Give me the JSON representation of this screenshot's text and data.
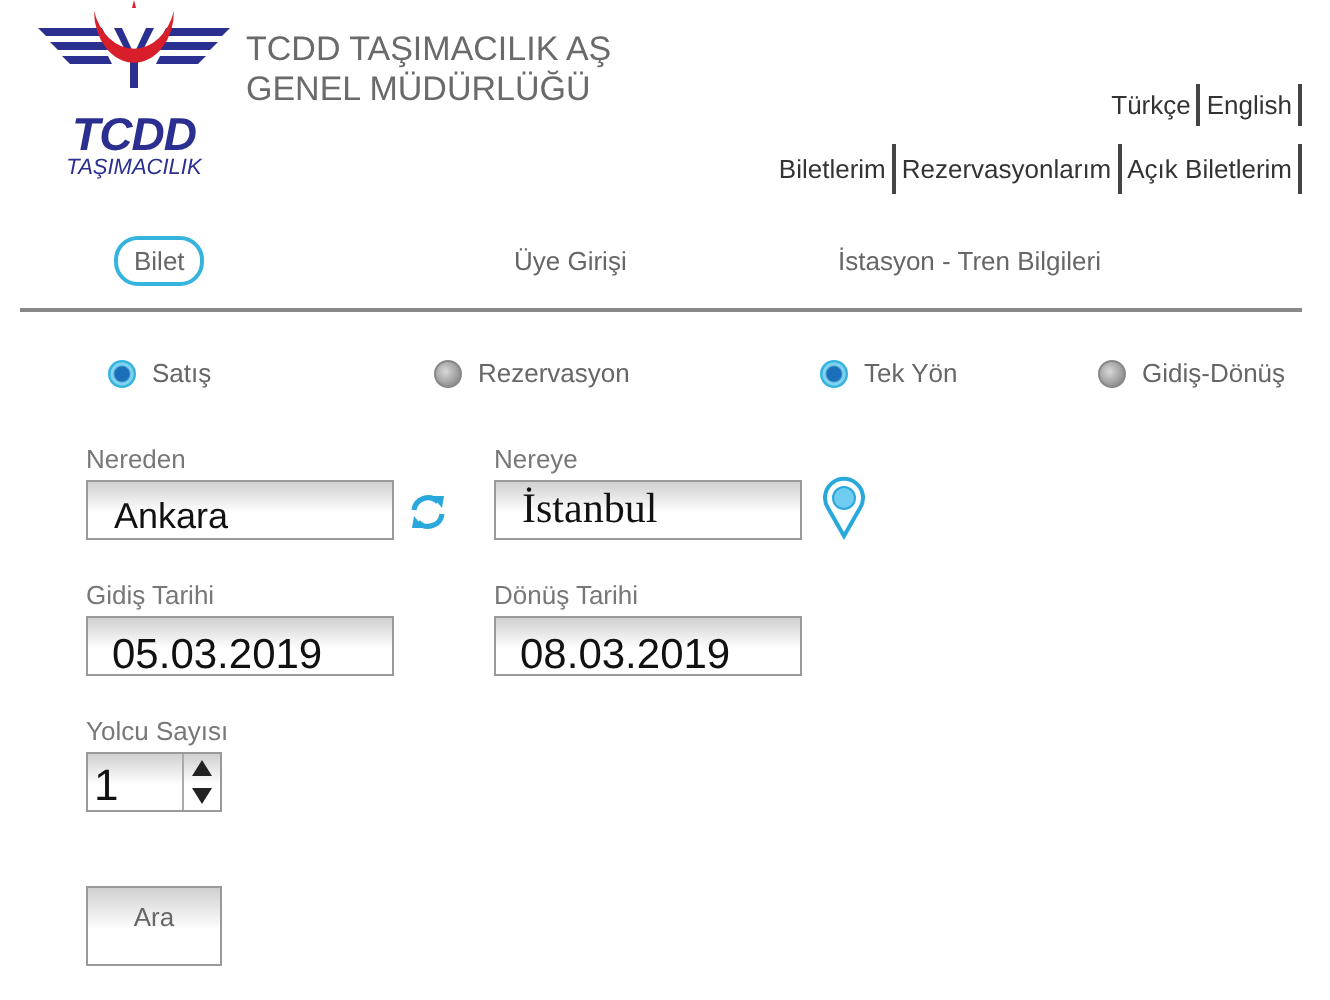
{
  "logo": {
    "name": "TCDD",
    "subtitle": "TAŞIMACILIK"
  },
  "title_lines": [
    "TCDD TAŞIMACILIK AŞ",
    "GENEL MÜDÜRLÜĞÜ"
  ],
  "languages": [
    "Türkçe",
    "English"
  ],
  "account_links": [
    "Biletlerim",
    "Rezervasyonlarım",
    "Açık Biletlerim"
  ],
  "tabs": [
    {
      "label": "Bilet",
      "selected": true
    },
    {
      "label": "Üye Girişi",
      "selected": false
    },
    {
      "label": "İstasyon - Tren Bilgileri",
      "selected": false
    }
  ],
  "options": [
    {
      "label": "Satış",
      "selected": true
    },
    {
      "label": "Rezervasyon",
      "selected": false
    },
    {
      "label": "Tek Yön",
      "selected": true
    },
    {
      "label": "Gidiş-Dönüş",
      "selected": false
    }
  ],
  "route": [
    {
      "label": "Nereden",
      "value": "Ankara"
    },
    {
      "label": "Nereye",
      "value": "İstanbul"
    }
  ],
  "dates": [
    {
      "label": "Gidiş Tarihi",
      "value": "05.03.2019"
    },
    {
      "label": "Dönüş Tarihi",
      "value": "08.03.2019"
    }
  ],
  "passengers": {
    "label": "Yolcu Sayısı",
    "value": "1"
  },
  "search_button": "Ara"
}
